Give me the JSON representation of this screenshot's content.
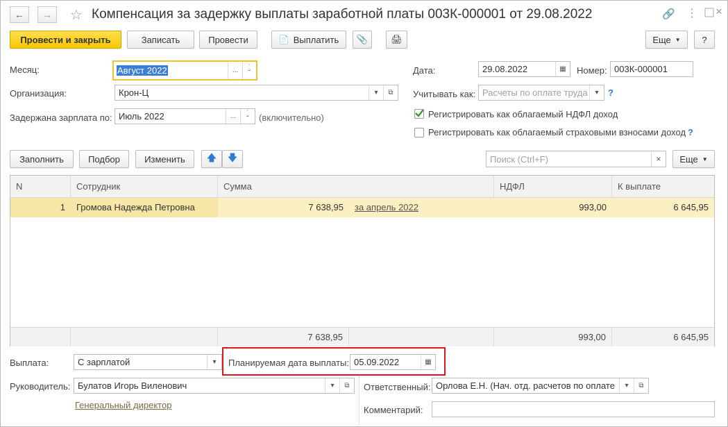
{
  "window": {
    "title": "Компенсация за задержку выплаты заработной платы 003К-000001 от 29.08.2022"
  },
  "toolbar": {
    "post_close": "Провести и закрыть",
    "save": "Записать",
    "post": "Провести",
    "pay": "Выплатить",
    "more": "Еще",
    "help": "?"
  },
  "form": {
    "month_label": "Месяц:",
    "month_value": "Август 2022",
    "org_label": "Организация:",
    "org_value": "Крон-Ц",
    "delayed_label": "Задержана зарплата по:",
    "delayed_value": "Июль 2022",
    "delayed_note": "(включительно)",
    "date_label": "Дата:",
    "date_value": "29.08.2022",
    "number_label": "Номер:",
    "number_value": "003К-000001",
    "account_label": "Учитывать как:",
    "account_placeholder": "Расчеты по оплате труда",
    "ndfl_check_label": "Регистрировать как облагаемый НДФЛ доход",
    "ins_check_label": "Регистрировать как облагаемый страховыми взносами доход",
    "q": "?"
  },
  "table_toolbar": {
    "fill": "Заполнить",
    "pick": "Подбор",
    "change": "Изменить",
    "search_placeholder": "Поиск (Ctrl+F)",
    "more": "Еще"
  },
  "table": {
    "headers": [
      "N",
      "Сотрудник",
      "Сумма",
      "НДФЛ",
      "К выплате"
    ],
    "rows": [
      {
        "n": "1",
        "employee": "Громова Надежда Петровна",
        "sum": "7 638,95",
        "period": "за апрель 2022",
        "ndfl": "993,00",
        "pay": "6 645,95"
      }
    ],
    "totals": {
      "sum": "7 638,95",
      "ndfl": "993,00",
      "pay": "6 645,95"
    }
  },
  "bottom": {
    "payout_label": "Выплата:",
    "payout_value": "С зарплатой",
    "planned_label": "Планируемая дата выплаты:",
    "planned_value": "05.09.2022",
    "head_label": "Руководитель:",
    "head_value": "Булатов Игорь Виленович",
    "head_position": "Генеральный директор",
    "resp_label": "Ответственный:",
    "resp_value": "Орлова Е.Н. (Нач. отд. расчетов по оплате",
    "comment_label": "Комментарий:",
    "comment_value": ""
  },
  "colors": {
    "accent_yellow": "#f6c800",
    "selected_row": "#fbf0c2",
    "highlight_red": "#e0161c",
    "link_blue": "#2d7bd1",
    "check_green": "#3c9a2e"
  }
}
